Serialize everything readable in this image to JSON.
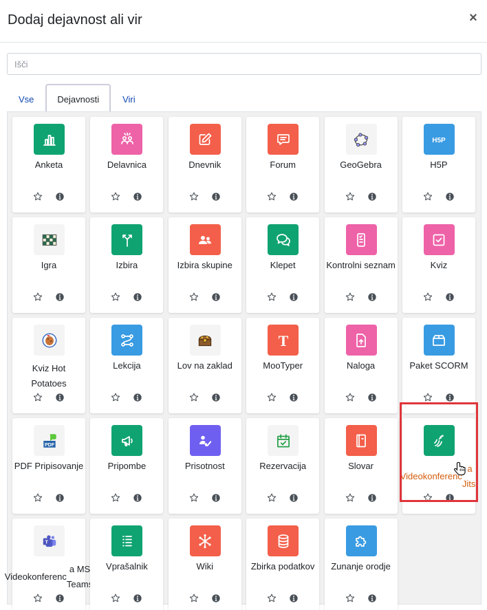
{
  "modal": {
    "title": "Dodaj dejavnost ali vir",
    "close_label": "×"
  },
  "search": {
    "placeholder": "Išči",
    "value": ""
  },
  "tabs": [
    {
      "label": "Vse",
      "active": false
    },
    {
      "label": "Dejavnosti",
      "active": true
    },
    {
      "label": "Viri",
      "active": false
    }
  ],
  "colors": {
    "green": "#10a372",
    "pink": "#ee62a8",
    "red": "#f35f4a",
    "blue": "#399be2",
    "purple": "#6f5ff0",
    "plain_bg": "#f4f4f4",
    "highlight": "#e0353b",
    "orange_text": "#d35c0c",
    "link": "#0f47ad"
  },
  "modules": [
    {
      "label": "Anketa",
      "icon": "bar-chart-icon",
      "color": "green"
    },
    {
      "label": "Delavnica",
      "icon": "workshop-icon",
      "color": "pink"
    },
    {
      "label": "Dnevnik",
      "icon": "pencil-square-icon",
      "color": "red"
    },
    {
      "label": "Forum",
      "icon": "speech-bubble-icon",
      "color": "red"
    },
    {
      "label": "GeoGebra",
      "icon": "geogebra-icon",
      "color": "plain"
    },
    {
      "label": "H5P",
      "icon": "h5p-icon",
      "color": "blue"
    },
    {
      "label": "Igra",
      "icon": "game-board-icon",
      "color": "plain"
    },
    {
      "label": "Izbira",
      "icon": "signpost-icon",
      "color": "green"
    },
    {
      "label": "Izbira skupine",
      "icon": "group-icon",
      "color": "red"
    },
    {
      "label": "Klepet",
      "icon": "chat-bubbles-icon",
      "color": "green"
    },
    {
      "label": "Kontrolni seznam",
      "icon": "checklist-icon",
      "color": "pink"
    },
    {
      "label": "Kviz",
      "icon": "check-square-icon",
      "color": "pink"
    },
    {
      "label": "Kviz Hot Potatoes",
      "icon": "hot-potatoes-icon",
      "color": "plain"
    },
    {
      "label": "Lekcija",
      "icon": "lesson-path-icon",
      "color": "blue"
    },
    {
      "label": "Lov na zaklad",
      "icon": "treasure-chest-icon",
      "color": "plain"
    },
    {
      "label": "MooTyper",
      "icon": "letter-t-icon",
      "color": "red"
    },
    {
      "label": "Naloga",
      "icon": "file-upload-icon",
      "color": "pink"
    },
    {
      "label": "Paket SCORM",
      "icon": "package-box-icon",
      "color": "blue"
    },
    {
      "label": "PDF Pripisovanje",
      "icon": "pdf-annotation-icon",
      "color": "plain"
    },
    {
      "label": "Pripombe",
      "icon": "megaphone-icon",
      "color": "green"
    },
    {
      "label": "Prisotnost",
      "icon": "attendance-icon",
      "color": "purple"
    },
    {
      "label": "Rezervacija",
      "icon": "calendar-check-icon",
      "color": "plain"
    },
    {
      "label": "Slovar",
      "icon": "book-icon",
      "color": "red"
    },
    {
      "label": "Videokonferenca Jitsi",
      "label_lines": [
        "Videokonferenc",
        "a Jitsi"
      ],
      "icon": "jitsi-icon",
      "color": "green",
      "highlight": true
    },
    {
      "label": "Videokonferenca MS Teams",
      "label_lines": [
        "Videokonferenc",
        "a MS Teams"
      ],
      "icon": "ms-teams-icon",
      "color": "plain"
    },
    {
      "label": "Vprašalnik",
      "icon": "list-icon",
      "color": "green"
    },
    {
      "label": "Wiki",
      "icon": "network-icon",
      "color": "red"
    },
    {
      "label": "Zbirka podatkov",
      "icon": "database-icon",
      "color": "red"
    },
    {
      "label": "Zunanje orodje",
      "icon": "puzzle-piece-icon",
      "color": "blue"
    }
  ]
}
